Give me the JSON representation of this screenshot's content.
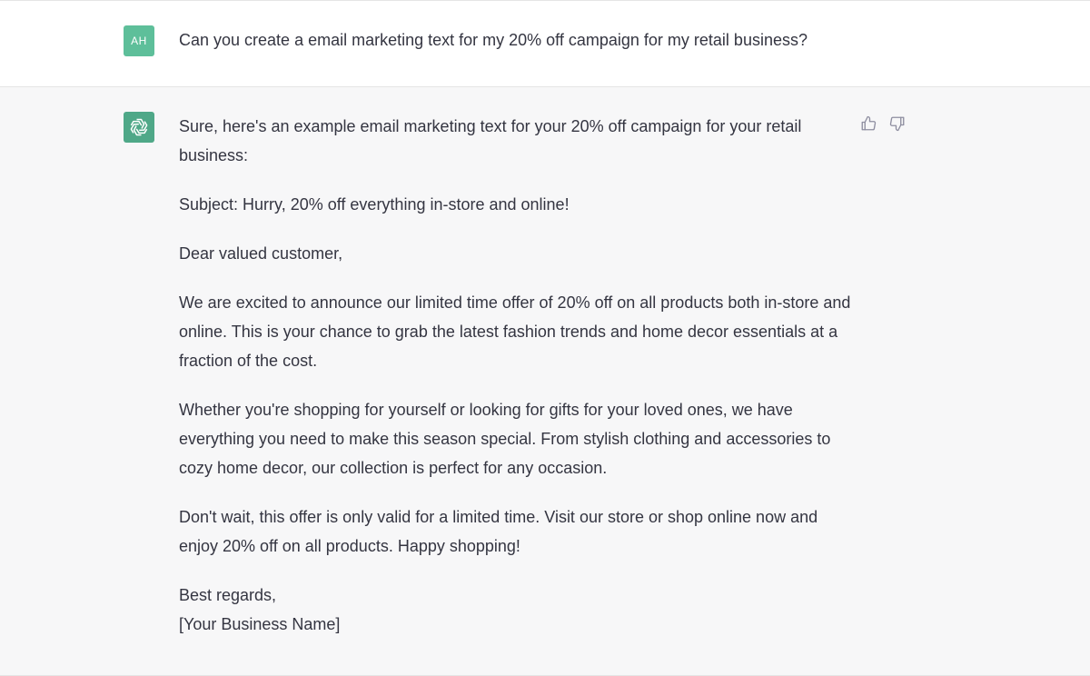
{
  "user_message": {
    "avatar_initials": "AH",
    "text": "Can you create a email marketing text for my 20% off campaign for my retail business?"
  },
  "assistant_message": {
    "avatar_icon": "openai-logo-icon",
    "intro": "Sure, here's an example email marketing text for your 20% off campaign for your retail business:",
    "subject": "Subject: Hurry, 20% off everything in-store and online!",
    "greeting": "Dear valued customer,",
    "paragraph_1": "We are excited to announce our limited time offer of 20% off on all products both in-store and online. This is your chance to grab the latest fashion trends and home decor essentials at a fraction of the cost.",
    "paragraph_2": "Whether you're shopping for yourself or looking for gifts for your loved ones, we have everything you need to make this season special. From stylish clothing and accessories to cozy home decor, our collection is perfect for any occasion.",
    "paragraph_3": "Don't wait, this offer is only valid for a limited time. Visit our store or shop online now and enjoy 20% off on all products. Happy shopping!",
    "signoff": "Best regards,",
    "signature": "[Your Business Name]",
    "feedback_icons": [
      "thumbs-up-icon",
      "thumbs-down-icon"
    ]
  },
  "colors": {
    "user_avatar_bg": "#5ebf9a",
    "bot_avatar_bg": "#4fa888",
    "assistant_bg": "#f7f7f8",
    "text": "#343541"
  }
}
